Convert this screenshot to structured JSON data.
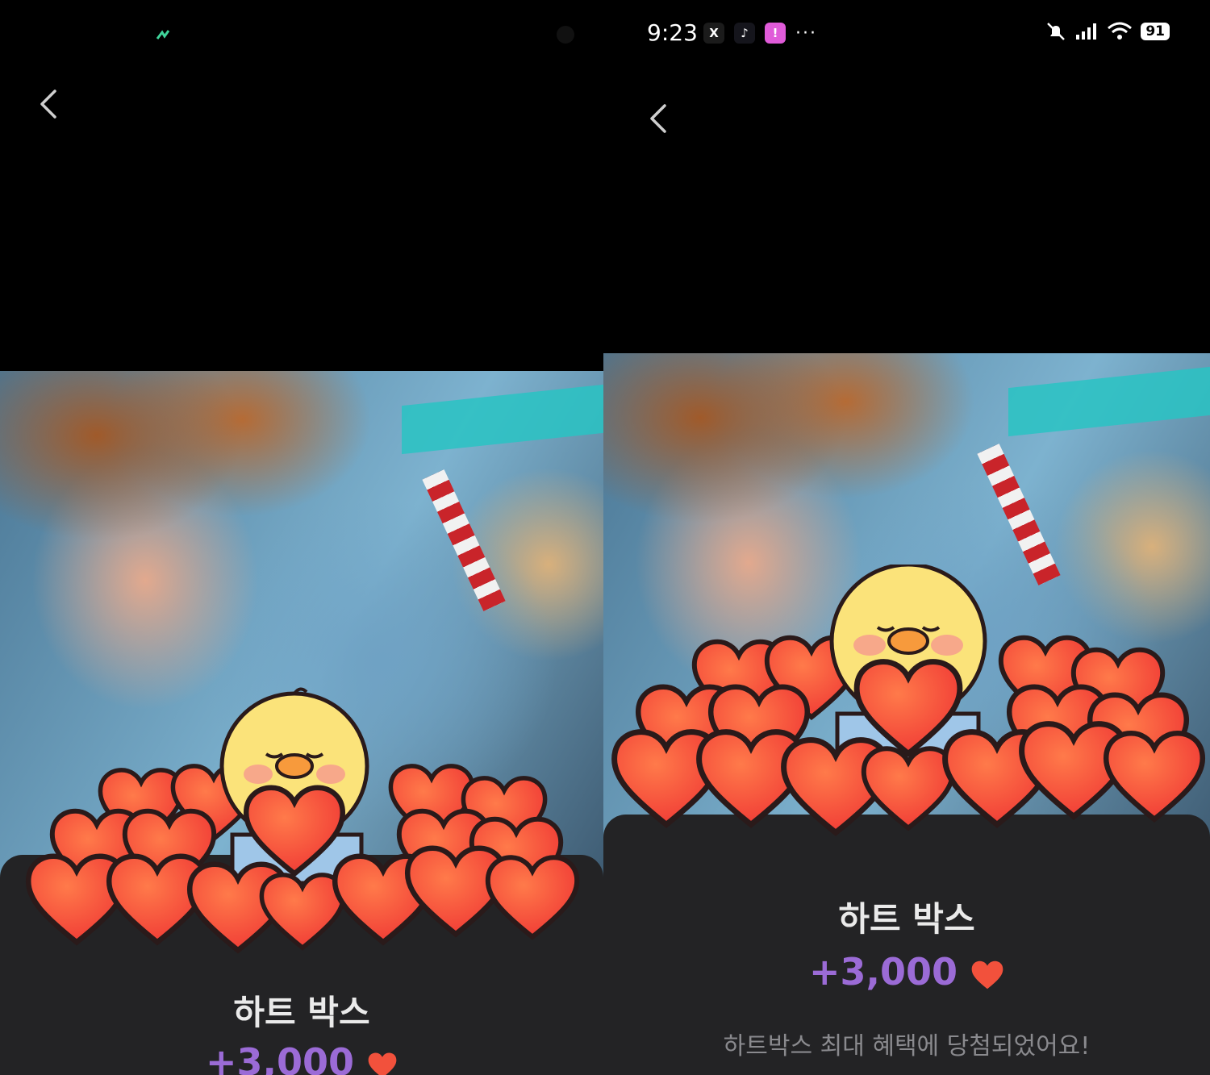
{
  "status_bar": {
    "time": "9:23",
    "apps": [
      "X",
      "♪",
      "!"
    ],
    "more": "···",
    "battery": "91"
  },
  "heart_box": {
    "title": "하트 박스",
    "reward": "+3,000",
    "message": "하트박스 최대 혜택에 당첨되었어요!"
  },
  "colors": {
    "reward": "#9b6bd6",
    "sheet": "#232325",
    "heart": "#f2513c"
  }
}
